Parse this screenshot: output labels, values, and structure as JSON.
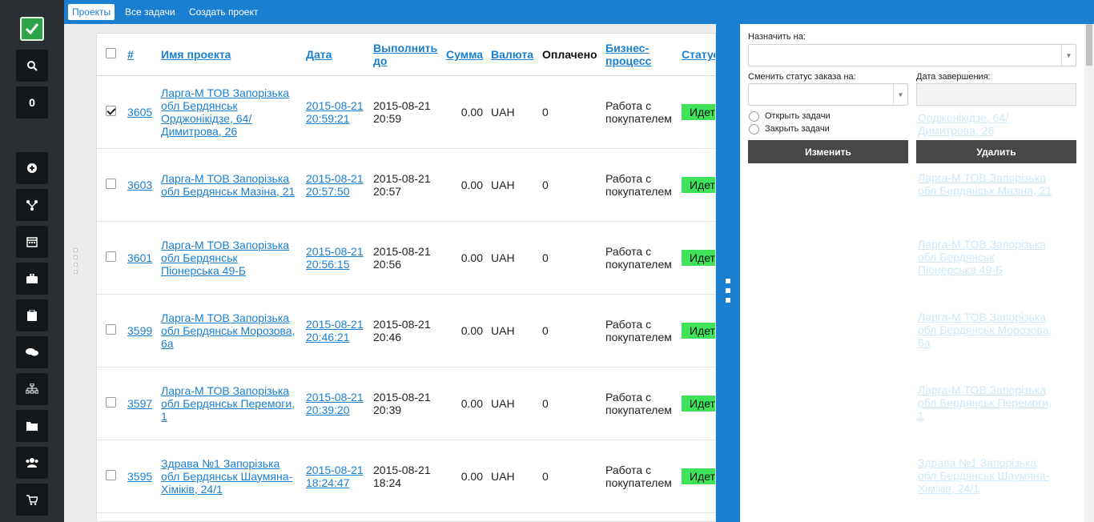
{
  "topbar": {
    "tabs": [
      {
        "label": "Проекты"
      },
      {
        "label": "Все задачи"
      },
      {
        "label": "Создать проект"
      }
    ]
  },
  "sidebar": {
    "counter": "0",
    "icons": [
      "search-icon",
      "plus-circle-icon",
      "fork-icon",
      "calendar-icon",
      "briefcase-icon",
      "clipboard-icon",
      "chat-icon",
      "sitemap-icon",
      "folder-icon",
      "users-icon",
      "cart-icon"
    ]
  },
  "table": {
    "headers": {
      "num": "#",
      "name": "Имя проекта",
      "date": "Дата",
      "due": "Выполнить до",
      "sum": "Сумма",
      "currency": "Валюта",
      "paid": "Оплачено",
      "process": "Бизнес-процесс",
      "status": "Статус"
    },
    "rows": [
      {
        "checked": true,
        "id": "3605",
        "name": "Ларга-М ТОВ Запорізька обл Бердянськ Орджонікідзе, 64/ Димитрова, 26",
        "date": "2015-08-21 20:59:21",
        "due": "2015-08-21 20:59",
        "sum": "0.00",
        "currency": "UAH",
        "paid": "0",
        "process": "Работа с покупателем",
        "status": "Идет работа с покупателем"
      },
      {
        "checked": false,
        "id": "3603",
        "name": "Ларга-М ТОВ Запорізька обл Бердянськ Мазіна, 21",
        "date": "2015-08-21 20:57:50",
        "due": "2015-08-21 20:57",
        "sum": "0.00",
        "currency": "UAH",
        "paid": "0",
        "process": "Работа с покупателем",
        "status": "Идет работа с покупателем"
      },
      {
        "checked": false,
        "id": "3601",
        "name": "Ларга-М ТОВ Запорізька обл Бердянськ Піонерська 49-Б",
        "date": "2015-08-21 20:56:15",
        "due": "2015-08-21 20:56",
        "sum": "0.00",
        "currency": "UAH",
        "paid": "0",
        "process": "Работа с покупателем",
        "status": "Идет работа с покупателем"
      },
      {
        "checked": false,
        "id": "3599",
        "name": "Ларга-М ТОВ Запорізька обл Бердянськ Морозова, 6а",
        "date": "2015-08-21 20:46:21",
        "due": "2015-08-21 20:46",
        "sum": "0.00",
        "currency": "UAH",
        "paid": "0",
        "process": "Работа с покупателем",
        "status": "Идет работа с покупателем"
      },
      {
        "checked": false,
        "id": "3597",
        "name": "Ларга-М ТОВ Запорізька обл Бердянськ Перемоги, 1",
        "date": "2015-08-21 20:39:20",
        "due": "2015-08-21 20:39",
        "sum": "0.00",
        "currency": "UAH",
        "paid": "0",
        "process": "Работа с покупателем",
        "status": "Идет работа с покупателем"
      },
      {
        "checked": false,
        "id": "3595",
        "name": "Здрава №1 Запорізька обл Бердянськ Шаумяна-Хіміків, 24/1",
        "date": "2015-08-21 18:24:47",
        "due": "2015-08-21 18:24",
        "sum": "0.00",
        "currency": "UAH",
        "paid": "0",
        "process": "Работа с покупателем",
        "status": "Идет работа с покупателем"
      }
    ]
  },
  "panel": {
    "assign_label": "Назначить на:",
    "assign_value": "",
    "status_label": "Сменить статус заказа на:",
    "status_value": "",
    "date_label": "Дата завершения:",
    "date_value": "",
    "radio_open": "Открыть задачи",
    "radio_close": "Закрыть задачи",
    "change_btn": "Изменить",
    "delete_btn": "Удалить"
  },
  "colors": {
    "accent": "#1a7fd0",
    "sidebar": "#2b2f33",
    "status_green": "#3fe35a",
    "button_dark": "#474747"
  }
}
